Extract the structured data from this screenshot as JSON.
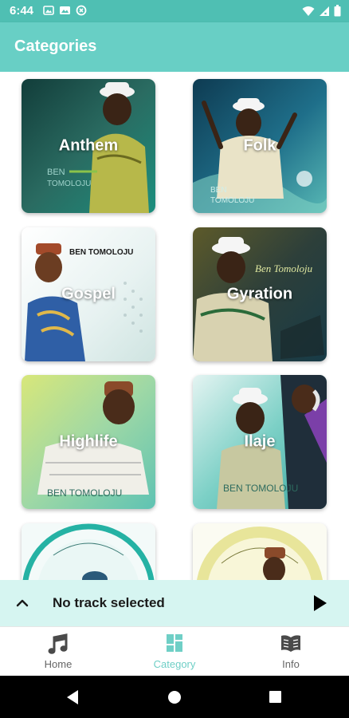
{
  "status_bar": {
    "time": "6:44",
    "left_icons": [
      "image-icon",
      "gallery-icon",
      "data-saver-icon"
    ],
    "right_icons": [
      "wifi-icon",
      "signal-icon",
      "battery-icon"
    ]
  },
  "app_bar": {
    "title": "Categories"
  },
  "categories": [
    {
      "label": "Anthem",
      "watermark": "BEN TOMOLOJU"
    },
    {
      "label": "Folk",
      "watermark": "BEN TOMOLOJU"
    },
    {
      "label": "Gospel",
      "watermark": "BEN TOMOLOJU"
    },
    {
      "label": "Gyration",
      "watermark": "Ben Tomoloju"
    },
    {
      "label": "Highlife",
      "watermark": "BEN TOMOLOJU"
    },
    {
      "label": "Ilaje",
      "watermark": "BEN TOMOLOJU"
    }
  ],
  "player": {
    "title": "No track selected"
  },
  "bottom_nav": [
    {
      "label": "Home",
      "icon": "music-note-icon",
      "active": false
    },
    {
      "label": "Category",
      "icon": "grid-icon",
      "active": true
    },
    {
      "label": "Info",
      "icon": "book-icon",
      "active": false
    }
  ],
  "colors": {
    "status_bar": "#4fbfb3",
    "app_bar": "#68cfc5",
    "player_bar": "#d6f5f1",
    "nav_active": "#6fcfc6"
  }
}
